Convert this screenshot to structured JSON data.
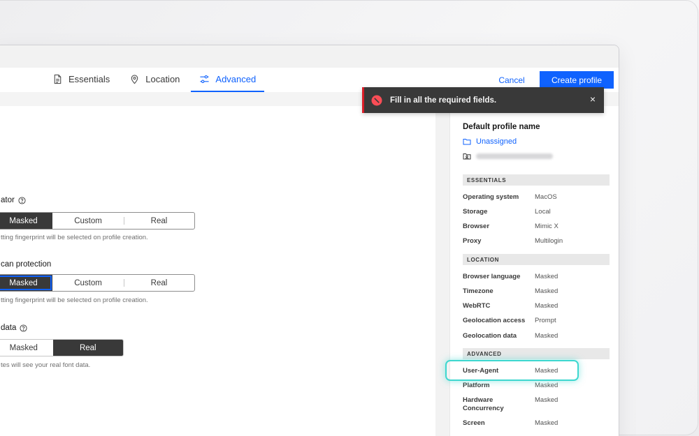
{
  "header": {
    "tabs": [
      {
        "label": "Essentials",
        "icon": "document-icon",
        "active": false
      },
      {
        "label": "Location",
        "icon": "location-pin-icon",
        "active": false
      },
      {
        "label": "Advanced",
        "icon": "sliders-icon",
        "active": true
      }
    ],
    "cancel_label": "Cancel",
    "create_label": "Create profile"
  },
  "main": {
    "sections": [
      {
        "title": "ator",
        "options": [
          "Masked",
          "Custom",
          "Real"
        ],
        "selected": "Masked",
        "hint": "tting fingerprint will be selected on profile creation."
      },
      {
        "title": "can protection",
        "options": [
          "Masked",
          "Custom",
          "Real"
        ],
        "selected": "Masked",
        "hint": "tting fingerprint will be selected on profile creation."
      },
      {
        "title": "data",
        "options": [
          "Masked",
          "Real"
        ],
        "selected": "Real",
        "hint": "tes will see your real font data."
      }
    ]
  },
  "toast": {
    "message": "Fill in all the required fields.",
    "close_glyph": "×",
    "kind": "error",
    "color": "#da1e28"
  },
  "summary": {
    "profile_name": "Default profile name",
    "folder": "Unassigned",
    "essentials_head": "ESSENTIALS",
    "essentials": [
      {
        "k": "Operating system",
        "v": "MacOS"
      },
      {
        "k": "Storage",
        "v": "Local"
      },
      {
        "k": "Browser",
        "v": "Mimic X"
      },
      {
        "k": "Proxy",
        "v": "Multilogin"
      }
    ],
    "location_head": "LOCATION",
    "location": [
      {
        "k": "Browser language",
        "v": "Masked"
      },
      {
        "k": "Timezone",
        "v": "Masked"
      },
      {
        "k": "WebRTC",
        "v": "Masked"
      },
      {
        "k": "Geolocation access",
        "v": "Prompt"
      },
      {
        "k": "Geolocation data",
        "v": "Masked"
      }
    ],
    "advanced_head": "ADVANCED",
    "advanced": [
      {
        "k": "User-Agent",
        "v": "Masked"
      },
      {
        "k": "Platform",
        "v": "Masked"
      },
      {
        "k": "Hardware Concurrency",
        "v": "Masked"
      },
      {
        "k": "Screen",
        "v": "Masked"
      }
    ]
  },
  "colors": {
    "accent": "#0f62fe",
    "highlight": "#3ed7cf"
  }
}
